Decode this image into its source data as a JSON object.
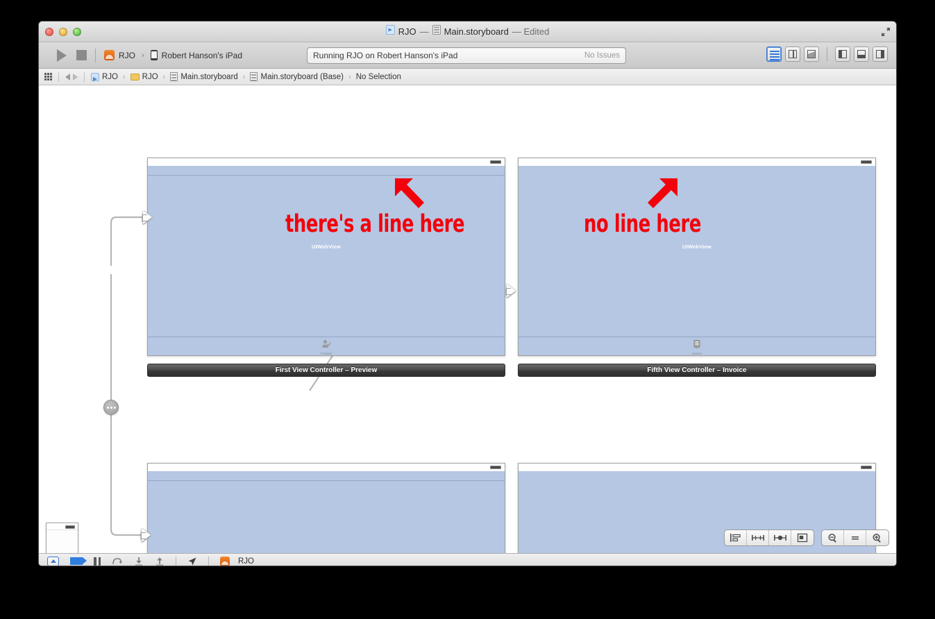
{
  "window": {
    "title_project": "RJO",
    "title_dash1": "—",
    "title_file": "Main.storyboard",
    "title_edited": "— Edited",
    "fullscreen_icon": "fullscreen-arrows-icon"
  },
  "toolbar": {
    "run_icon": "run-play-icon",
    "stop_icon": "stop-square-icon",
    "scheme_name": "RJO",
    "scheme_separator": "›",
    "destination_name": "Robert Hanson's iPad",
    "status_text": "Running RJO on Robert Hanson's iPad",
    "status_issues": "No Issues",
    "editor_buttons": [
      {
        "name": "standard-editor-button",
        "icon": "lines-icon",
        "active": true
      },
      {
        "name": "assistant-editor-button",
        "icon": "assistant-editor-icon",
        "active": false
      },
      {
        "name": "version-editor-button",
        "icon": "version-editor-icon",
        "active": false
      }
    ],
    "view_buttons": [
      {
        "name": "toggle-navigator-button",
        "icon": "panel-left-icon"
      },
      {
        "name": "toggle-debug-area-button",
        "icon": "panel-bottom-icon"
      },
      {
        "name": "toggle-utilities-button",
        "icon": "panel-right-icon"
      }
    ]
  },
  "jumpbar": {
    "grid_icon": "related-items-icon",
    "back_icon": "back-arrow-icon",
    "forward_icon": "forward-arrow-icon",
    "crumbs": [
      {
        "label": "RJO",
        "icon": "xcode-project-icon"
      },
      {
        "label": "RJO",
        "icon": "folder-icon"
      },
      {
        "label": "Main.storyboard",
        "icon": "storyboard-icon"
      },
      {
        "label": "Main.storyboard (Base)",
        "icon": "storyboard-icon"
      },
      {
        "label": "No Selection",
        "icon": "none"
      }
    ],
    "separator": "›"
  },
  "canvas": {
    "webview_label": "UIWebView",
    "scenes": [
      {
        "id": "first-view-controller-preview",
        "label": "First View Controller – Preview",
        "has_top_divider": true,
        "tab_item_glyph": "👤",
        "tab_item_caption": "Preview"
      },
      {
        "id": "fifth-view-controller-invoice",
        "label": "Fifth View Controller – Invoice",
        "has_top_divider": false,
        "tab_item_glyph": "📄",
        "tab_item_caption": "Invoice"
      },
      {
        "id": "bottom-left-view-controller",
        "label": "",
        "has_top_divider": true,
        "tab_item_glyph": "",
        "tab_item_caption": ""
      },
      {
        "id": "bottom-right-view-controller",
        "label": "",
        "has_top_divider": false,
        "tab_item_glyph": "",
        "tab_item_caption": ""
      }
    ],
    "annotations": [
      {
        "id": "annotation-line-present",
        "text": "there's a line here",
        "arrow": "arrow-up-left-icon"
      },
      {
        "id": "annotation-no-line",
        "text": "no line here",
        "arrow": "arrow-up-right-icon"
      }
    ],
    "tab_bar_controller_node": "tab-bar-controller-node",
    "mini_scene_play_icon": "initial-view-controller-indicator"
  },
  "canvas_controls": {
    "autolayout": [
      {
        "name": "align-button",
        "icon": "align-icon"
      },
      {
        "name": "pin-button",
        "icon": "pin-icon"
      },
      {
        "name": "resolve-issues-button",
        "icon": "resolve-auto-layout-issues-icon"
      },
      {
        "name": "resizing-behavior-button",
        "icon": "resizing-behavior-icon"
      }
    ],
    "zoom": [
      {
        "name": "zoom-out-button",
        "icon": "zoom-out-icon"
      },
      {
        "name": "zoom-actual-size-button",
        "icon": "zoom-equal-icon"
      },
      {
        "name": "zoom-in-button",
        "icon": "zoom-in-icon"
      }
    ]
  },
  "debugbar": {
    "hide_debug_icon": "hide-debug-area-icon",
    "breakpoints_icon": "breakpoints-activate-icon",
    "pause_icon": "pause-icon",
    "step_over_icon": "step-over-icon",
    "step_into_icon": "step-into-icon",
    "step_out_icon": "step-out-icon",
    "location_icon": "simulate-location-icon",
    "process_name": "RJO",
    "process_icon": "rjo-app-icon"
  },
  "colors": {
    "webview_blue": "#b5c7e3",
    "annotation_red": "#f2020b",
    "accent_blue": "#3478d6",
    "scene_label_dark": "#3a3a3a"
  }
}
